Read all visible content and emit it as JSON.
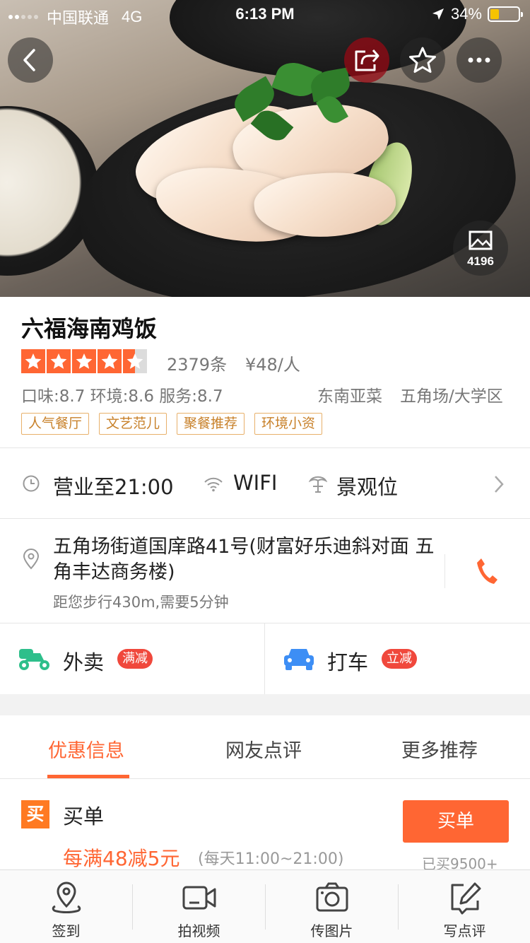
{
  "status_bar": {
    "carrier": "中国联通",
    "network": "4G",
    "time": "6:13 PM",
    "battery": "34%"
  },
  "hero": {
    "photo_count": "4196",
    "icons": [
      "back-icon",
      "share-icon",
      "star-icon",
      "more-icon",
      "photo-icon"
    ]
  },
  "restaurant": {
    "name": "六福海南鸡饭",
    "rating_stars": 4.5,
    "review_count": "2379条",
    "price": "¥48/人",
    "scores": "口味:8.7 环境:8.6 服务:8.7",
    "cuisine": "东南亚菜",
    "area": "五角场/大学区",
    "tags": [
      "人气餐厅",
      "文艺范儿",
      "聚餐推荐",
      "环境小资"
    ]
  },
  "features": {
    "hours": "营业至21:00",
    "wifi": "WIFI",
    "view": "景观位"
  },
  "address": {
    "text": "五角场街道国庠路41号(财富好乐迪斜对面 五角丰达商务楼)",
    "distance": "距您步行430m,需要5分钟"
  },
  "services": {
    "delivery": {
      "label": "外卖",
      "badge": "满减"
    },
    "taxi": {
      "label": "打车",
      "badge": "立减"
    }
  },
  "tabs": [
    "优惠信息",
    "网友点评",
    "更多推荐"
  ],
  "deal": {
    "icon_text": "买",
    "title": "买单",
    "promo": "每满48减5元",
    "hours": "(每天11:00~21:00)",
    "button": "买单",
    "sold": "已买9500+"
  },
  "bottom_bar": [
    "签到",
    "拍视频",
    "传图片",
    "写点评"
  ],
  "colors": {
    "accent": "#ff6633",
    "tag_border": "#e8b06a",
    "badge": "#f0483c",
    "delivery_icon": "#2ebf8b",
    "taxi_icon": "#3d8ef5"
  }
}
